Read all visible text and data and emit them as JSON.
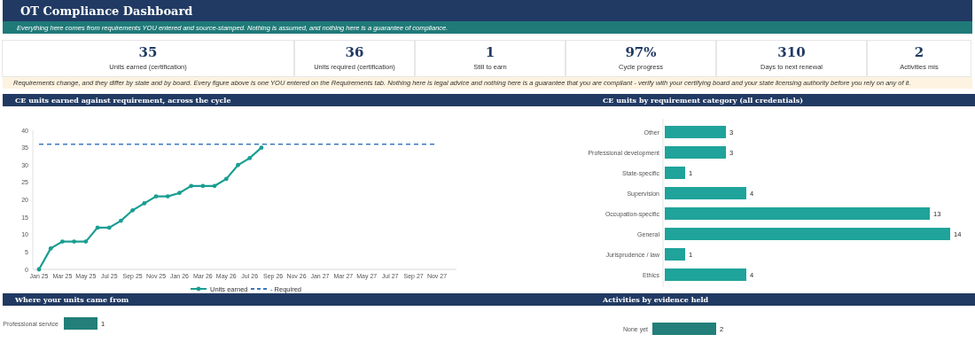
{
  "title": "OT Compliance Dashboard",
  "subtitle": "Everything here comes from requirements YOU entered and source-stamped. Nothing is assumed, and nothing here is a guarantee of compliance.",
  "kpis": [
    {
      "value": "35",
      "label": "Units earned (certification)"
    },
    {
      "value": "36",
      "label": "Units required (certification)"
    },
    {
      "value": "1",
      "label": "Still to earn"
    },
    {
      "value": "97%",
      "label": "Cycle progress"
    },
    {
      "value": "310",
      "label": "Days to next renewal"
    },
    {
      "value": "2",
      "label": "Activities mis"
    }
  ],
  "notice": "Requirements change, and they differ by state and by board. Every figure above is one YOU entered on the Requirements tab. Nothing here is legal advice and nothing here is a guarantee that you are compliant - verify with your certifying board and your state licensing authority before you rely on any of it.",
  "panels": [
    {
      "title": "CE units earned against requirement, across the cycle",
      "chart_data": {
        "type": "line",
        "legend": "bottom",
        "ylim": [
          0,
          40
        ],
        "yticks": [
          0,
          5,
          10,
          15,
          20,
          25,
          30,
          35,
          40
        ],
        "categories": [
          "Jan 25",
          null,
          "Mar 25",
          null,
          "May 25",
          null,
          "Jul 25",
          null,
          "Sep 25",
          null,
          "Nov 25",
          null,
          "Jan 26",
          null,
          "Mar 26",
          null,
          "May 26",
          null,
          "Jul 26",
          null,
          "Sep 26",
          null,
          "Nov 26",
          null,
          "Jan 27",
          null,
          "Mar 27",
          null,
          "May 27",
          null,
          "Jul 27",
          null,
          "Sep 27",
          null,
          "Nov 27"
        ],
        "series": [
          {
            "name": "Units earned",
            "color": "#1a9e92",
            "line_style": "solid",
            "values": [
              0,
              6,
              8,
              8,
              8,
              12,
              12,
              14,
              17,
              19,
              21,
              21,
              22,
              24,
              24,
              24,
              26,
              30,
              32,
              35,
              null,
              null,
              null,
              null,
              null,
              null,
              null,
              null,
              null,
              null,
              null,
              null,
              null,
              null,
              null
            ]
          },
          {
            "name": "- Required",
            "color": "#3a78c0",
            "line_style": "dashed",
            "values": [
              36,
              36,
              36,
              36,
              36,
              36,
              36,
              36,
              36,
              36,
              36,
              36,
              36,
              36,
              36,
              36,
              36,
              36,
              36,
              36,
              36,
              36,
              36,
              36,
              36,
              36,
              36,
              36,
              36,
              36,
              36,
              36,
              36,
              36,
              36
            ]
          }
        ]
      }
    },
    {
      "title": "CE units by requirement category (all credentials)",
      "chart_data": {
        "type": "bar",
        "orientation": "horizontal",
        "categories": [
          "Other",
          "Professional development",
          "State-specific",
          "Supervision",
          "Occupation-specific",
          "General",
          "Jurisprudence / law",
          "Ethics"
        ],
        "series": [
          {
            "color": "#1fa39a",
            "values": [
              3,
              3,
              1,
              4,
              13,
              14,
              1,
              4
            ]
          }
        ],
        "data_labels": true
      }
    },
    {
      "title": "Where your units came from",
      "chart_data": {
        "type": "bar",
        "orientation": "horizontal",
        "categories": [
          "Professional service"
        ],
        "series": [
          {
            "color": "#237f7a",
            "values": [
              1
            ]
          }
        ],
        "data_labels": true
      }
    },
    {
      "title": "Activities by evidence held",
      "chart_data": {
        "type": "bar",
        "orientation": "horizontal",
        "categories": [
          "None yet"
        ],
        "series": [
          {
            "color": "#237f7a",
            "values": [
              2
            ]
          }
        ],
        "data_labels": true
      }
    }
  ]
}
